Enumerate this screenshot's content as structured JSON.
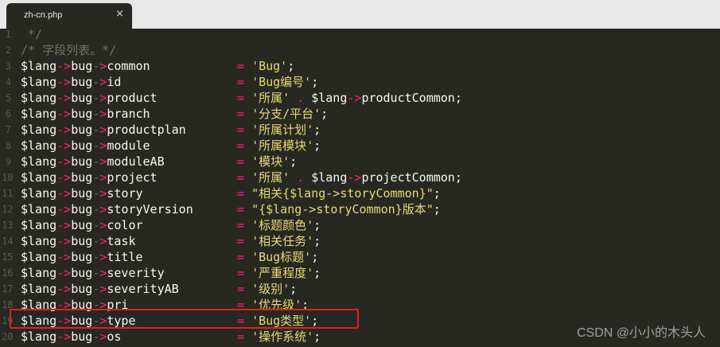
{
  "tab": {
    "title": "zh-cn.php",
    "close_glyph": "×"
  },
  "code_lines": [
    {
      "n": "1",
      "left": " */",
      "right": "",
      "type": "comment"
    },
    {
      "n": "2",
      "left": "/* 字段列表。*/",
      "right": "",
      "type": "comment"
    },
    {
      "n": "3",
      "left": "$lang->bug->common",
      "right": "= 'Bug';"
    },
    {
      "n": "4",
      "left": "$lang->bug->id",
      "right": "= 'Bug编号';"
    },
    {
      "n": "5",
      "left": "$lang->bug->product",
      "right": "= '所属' . $lang->productCommon;"
    },
    {
      "n": "6",
      "left": "$lang->bug->branch",
      "right": "= '分支/平台';"
    },
    {
      "n": "7",
      "left": "$lang->bug->productplan",
      "right": "= '所属计划';"
    },
    {
      "n": "8",
      "left": "$lang->bug->module",
      "right": "= '所属模块';"
    },
    {
      "n": "9",
      "left": "$lang->bug->moduleAB",
      "right": "= '模块';"
    },
    {
      "n": "10",
      "left": "$lang->bug->project",
      "right": "= '所属' . $lang->projectCommon;"
    },
    {
      "n": "11",
      "left": "$lang->bug->story",
      "right": "= \"相关{$lang->storyCommon}\";"
    },
    {
      "n": "12",
      "left": "$lang->bug->storyVersion",
      "right": "= \"{$lang->storyCommon}版本\";"
    },
    {
      "n": "13",
      "left": "$lang->bug->color",
      "right": "= '标题颜色';"
    },
    {
      "n": "14",
      "left": "$lang->bug->task",
      "right": "= '相关任务';"
    },
    {
      "n": "15",
      "left": "$lang->bug->title",
      "right": "= 'Bug标题';"
    },
    {
      "n": "16",
      "left": "$lang->bug->severity",
      "right": "= '严重程度';"
    },
    {
      "n": "17",
      "left": "$lang->bug->severityAB",
      "right": "= '级别';"
    },
    {
      "n": "18",
      "left": "$lang->bug->pri",
      "right": "= '优先级';"
    },
    {
      "n": "19",
      "left": "$lang->bug->type",
      "right": "= 'Bug类型';"
    },
    {
      "n": "20",
      "left": "$lang->bug->os",
      "right": "= '操作系统';"
    }
  ],
  "watermark": "CSDN @小小的木头人",
  "colors": {
    "background": "#272822",
    "tabbar": "#e8e8e8",
    "highlight": "#e0211b",
    "comment": "#75715e",
    "string": "#e6db74",
    "operator": "#f92672"
  }
}
